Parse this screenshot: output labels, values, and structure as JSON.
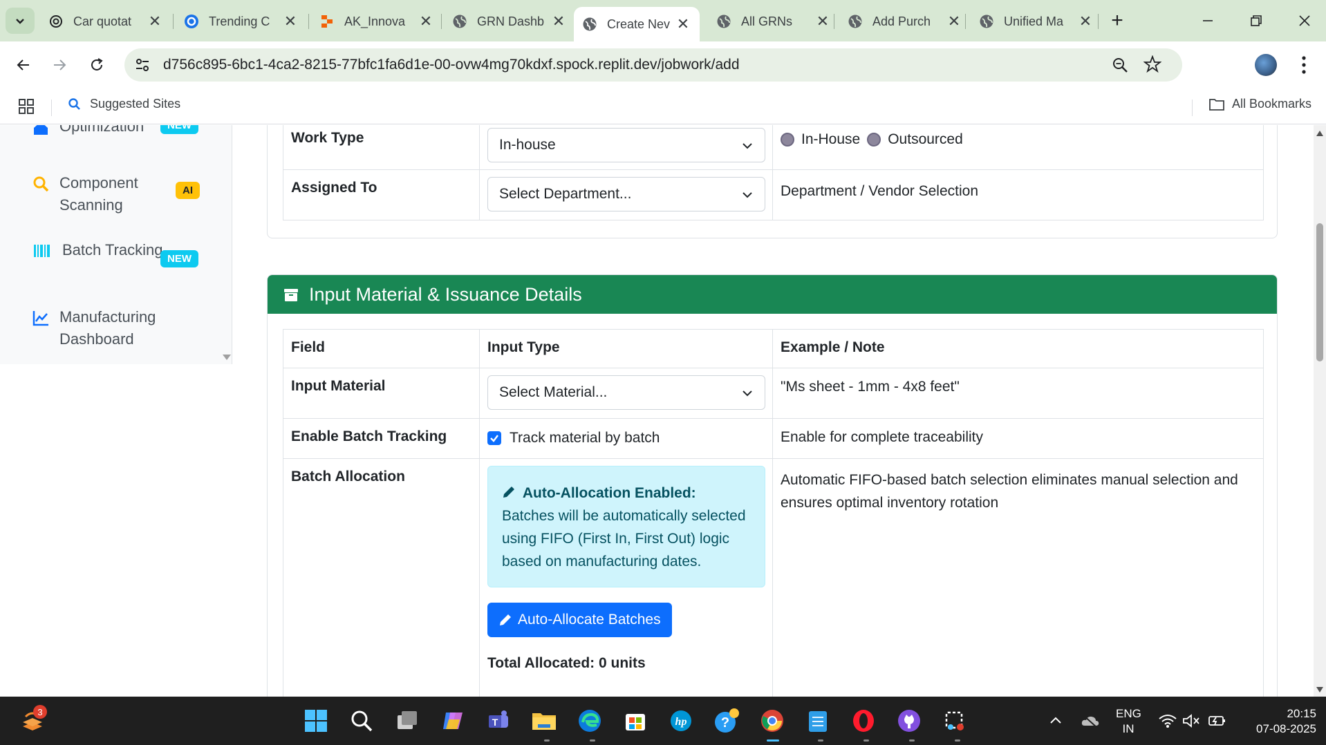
{
  "browser": {
    "tabs": [
      {
        "title": "Car quotat",
        "icon": "openai-icon"
      },
      {
        "title": "Trending C",
        "icon": "canva-icon"
      },
      {
        "title": "AK_Innova",
        "icon": "replit-icon"
      },
      {
        "title": "GRN Dashb",
        "icon": "globe-icon"
      },
      {
        "title": "Create Nev",
        "icon": "globe-icon",
        "active": true
      },
      {
        "title": "All GRNs",
        "icon": "globe-icon"
      },
      {
        "title": "Add Purch",
        "icon": "globe-icon"
      },
      {
        "title": "Unified Ma",
        "icon": "globe-icon"
      }
    ],
    "url": "d756c895-6bc1-4ca2-8215-77bfc1fa6d1e-00-ovw4mg70kdxf.spock.replit.dev/jobwork/add",
    "bookmarks": {
      "suggested": "Suggested Sites",
      "all": "All Bookmarks"
    }
  },
  "sidebar": {
    "items": [
      {
        "label": "Optimization",
        "badge": "NEW",
        "icon": "optimization-icon"
      },
      {
        "label": "Component Scanning",
        "badge": "AI",
        "icon": "search-icon"
      },
      {
        "label": "Batch Tracking",
        "badge": "NEW",
        "icon": "barcode-icon"
      },
      {
        "label": "Manufacturing Dashboard",
        "badge": "",
        "icon": "chart-line-icon"
      }
    ]
  },
  "top_section": {
    "rows": [
      {
        "field": "Work Type",
        "select_value": "In-house",
        "radio_options": [
          "In-House",
          "Outsourced"
        ]
      },
      {
        "field": "Assigned To",
        "select_value": "Select Department...",
        "note": "Department / Vendor Selection"
      }
    ]
  },
  "input_section": {
    "title": "Input Material & Issuance Details",
    "headers": [
      "Field",
      "Input Type",
      "Example / Note"
    ],
    "rows": {
      "input_material": {
        "field": "Input Material",
        "select_value": "Select Material...",
        "note": "\"Ms sheet - 1mm - 4x8 feet\""
      },
      "batch_tracking": {
        "field": "Enable Batch Tracking",
        "checkbox_label": "Track material by batch",
        "checked": true,
        "note": "Enable for complete traceability"
      },
      "batch_allocation": {
        "field": "Batch Allocation",
        "alert_title": "Auto-Allocation Enabled:",
        "alert_text": "Batches will be automatically selected using FIFO (First In, First Out) logic based on manufacturing dates.",
        "button_label": "Auto-Allocate Batches",
        "total_label": "Total Allocated: 0 units",
        "note": "Automatic FIFO-based batch selection eliminates manual selection and ensures optimal inventory rotation"
      }
    }
  },
  "taskbar": {
    "notification_count": "3",
    "lang": "ENG",
    "region": "IN",
    "time": "20:15",
    "date": "07-08-2025"
  },
  "colors": {
    "section_header": "#198754",
    "primary": "#0d6efd",
    "alert_bg": "#cff4fc",
    "badge_new": "#0dcaf0",
    "badge_ai": "#ffc107"
  }
}
